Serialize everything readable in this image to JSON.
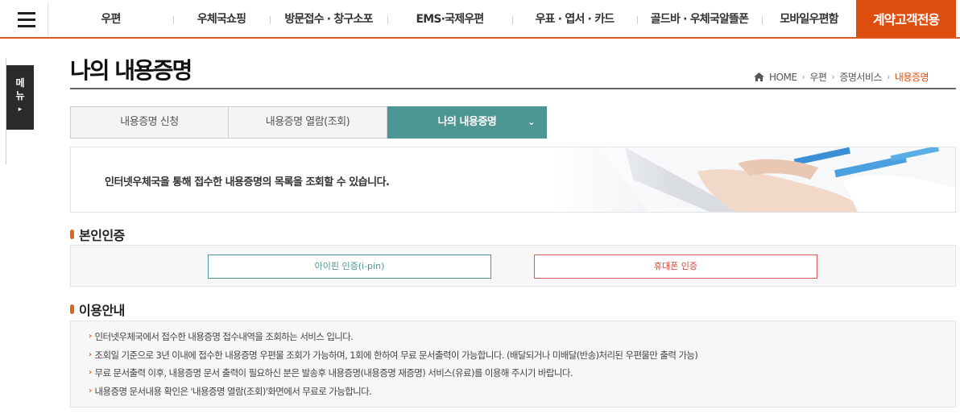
{
  "topnav": {
    "items": [
      {
        "label": "우편"
      },
      {
        "label": "우체국쇼핑"
      },
      {
        "label": "방문접수 · 창구소포"
      },
      {
        "label": "EMS·국제우편"
      },
      {
        "label": "우표 · 엽서 · 카드"
      },
      {
        "label": "골드바 · 우체국알뜰폰"
      },
      {
        "label": "모바일우편함"
      }
    ],
    "special": "계약고객전용",
    "accent_color": "#de4e0e"
  },
  "sidebar": {
    "tab_label": "메뉴",
    "arrow": "▸"
  },
  "page": {
    "title": "나의 내용증명"
  },
  "breadcrumb": {
    "home": "HOME",
    "items": [
      "우편",
      "증명서비스",
      "내용증명"
    ],
    "separator": "›"
  },
  "tabs": [
    {
      "label": "내용증명 신청"
    },
    {
      "label": "내용증명 열람(조회)"
    },
    {
      "label": "나의 내용증명",
      "active": true,
      "color": "#4e9694"
    }
  ],
  "tab_chevron": "⌄",
  "intro": {
    "text": "인터넷우체국을 통해 접수한 내용증명의 목록을 조회할 수 있습니다."
  },
  "auth": {
    "heading": "본인인증",
    "ipin_label": "아이핀 인증(i-pin)",
    "phone_label": "휴대폰 인증"
  },
  "guide": {
    "heading": "이용안내",
    "bullet": "›",
    "lines": [
      "인터넷우체국에서 접수한 내용증명 접수내역을 조회하는 서비스 입니다.",
      "조회일 기준으로 3년 이내에 접수한 내용증명 우편물 조회가 가능하며, 1회에 한하여 무료 문서출력이 가능합니다. (배달되거나 미배달(반송)처리된 우편물만 출력 가능)",
      "무료 문서출력 이후, 내용증명 문서 출력이 필요하신 분은 발송후 내용증명(내용증명 재증명) 서비스(유료)를 이용해 주시기 바랍니다.",
      "내용증명 문서내용 확인은 '내용증명 열람(조회)'화면에서 무료로 가능합니다."
    ]
  }
}
